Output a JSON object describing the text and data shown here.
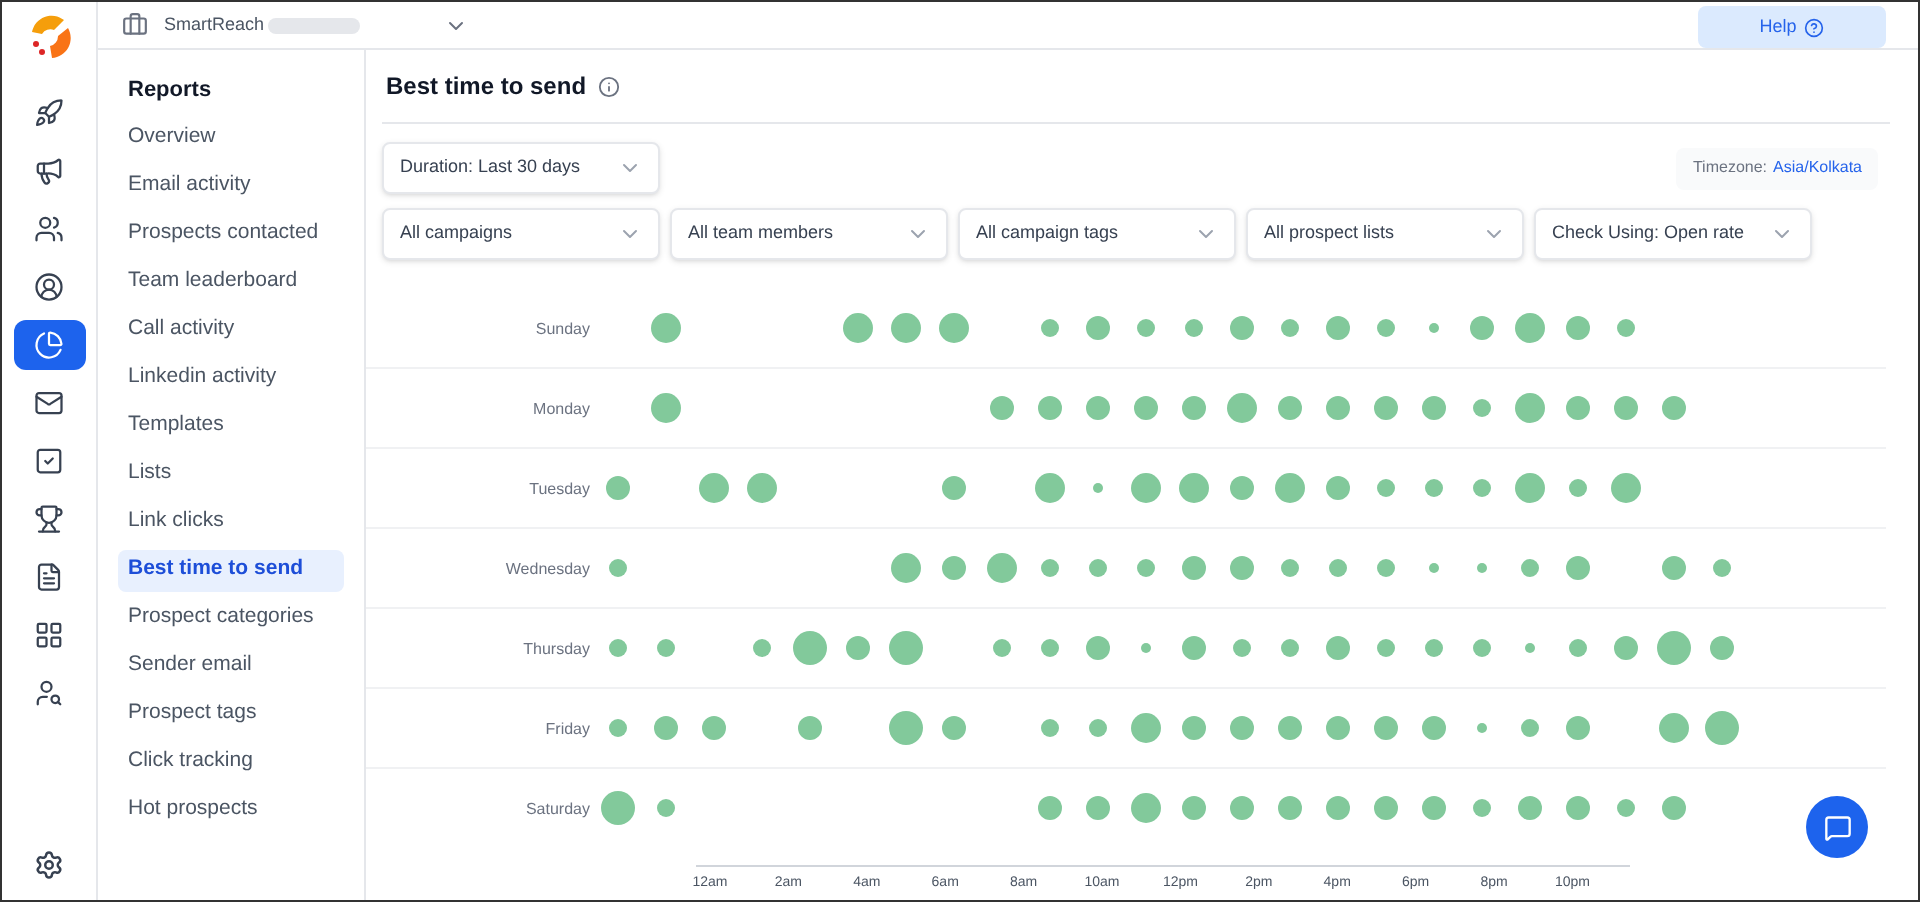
{
  "rail_items": [
    {
      "selected": false
    },
    {
      "selected": false
    },
    {
      "selected": false
    },
    {
      "selected": false
    },
    {
      "selected": true
    },
    {
      "selected": false
    },
    {
      "selected": false
    },
    {
      "selected": false
    },
    {
      "selected": false
    },
    {
      "selected": false
    },
    {
      "selected": false
    }
  ],
  "top_bar": {
    "workspace": "SmartReach",
    "help": "Help"
  },
  "sidebar": {
    "title": "Reports",
    "items": [
      {
        "label": "Overview",
        "selected": false
      },
      {
        "label": "Email activity",
        "selected": false
      },
      {
        "label": "Prospects contacted",
        "selected": false
      },
      {
        "label": "Team leaderboard",
        "selected": false
      },
      {
        "label": "Call activity",
        "selected": false
      },
      {
        "label": "Linkedin activity",
        "selected": false
      },
      {
        "label": "Templates",
        "selected": false
      },
      {
        "label": "Lists",
        "selected": false
      },
      {
        "label": "Link clicks",
        "selected": false
      },
      {
        "label": "Best time to send",
        "selected": true
      },
      {
        "label": "Prospect categories",
        "selected": false
      },
      {
        "label": "Sender email",
        "selected": false
      },
      {
        "label": "Prospect tags",
        "selected": false
      },
      {
        "label": "Click tracking",
        "selected": false
      },
      {
        "label": "Hot prospects",
        "selected": false
      }
    ]
  },
  "page": {
    "title": "Best time to send",
    "duration": "Duration: Last 30 days",
    "timezone_label": "Timezone:",
    "timezone_value": "Asia/Kolkata",
    "filters": [
      "All campaigns",
      "All team members",
      "All campaign tags",
      "All prospect lists",
      "Check Using: Open rate"
    ],
    "punch_card": {
      "rows": [
        {
          "day": "Sunday",
          "slots": [
            {
              "kind": "none"
            },
            {
              "kind": "l"
            },
            {
              "kind": "none"
            },
            {
              "kind": "none"
            },
            {
              "kind": "none"
            },
            {
              "kind": "l"
            },
            {
              "kind": "l"
            },
            {
              "kind": "l"
            },
            {
              "kind": "none"
            },
            {
              "kind": "s"
            },
            {
              "kind": "m"
            },
            {
              "kind": "s"
            },
            {
              "kind": "s"
            },
            {
              "kind": "m"
            },
            {
              "kind": "s"
            },
            {
              "kind": "m"
            },
            {
              "kind": "s"
            },
            {
              "kind": "xs"
            },
            {
              "kind": "m"
            },
            {
              "kind": "l"
            },
            {
              "kind": "m"
            },
            {
              "kind": "s"
            },
            {
              "kind": "none"
            },
            {
              "kind": "none"
            }
          ]
        },
        {
          "day": "Monday",
          "slots": [
            {
              "kind": "none"
            },
            {
              "kind": "l"
            },
            {
              "kind": "none"
            },
            {
              "kind": "none"
            },
            {
              "kind": "none"
            },
            {
              "kind": "none"
            },
            {
              "kind": "none"
            },
            {
              "kind": "none"
            },
            {
              "kind": "m"
            },
            {
              "kind": "m"
            },
            {
              "kind": "m"
            },
            {
              "kind": "m"
            },
            {
              "kind": "m"
            },
            {
              "kind": "l"
            },
            {
              "kind": "m"
            },
            {
              "kind": "m"
            },
            {
              "kind": "m"
            },
            {
              "kind": "m"
            },
            {
              "kind": "s"
            },
            {
              "kind": "l"
            },
            {
              "kind": "m"
            },
            {
              "kind": "m"
            },
            {
              "kind": "m"
            },
            {
              "kind": "none"
            }
          ]
        },
        {
          "day": "Tuesday",
          "slots": [
            {
              "kind": "m"
            },
            {
              "kind": "none"
            },
            {
              "kind": "l"
            },
            {
              "kind": "l"
            },
            {
              "kind": "none"
            },
            {
              "kind": "none"
            },
            {
              "kind": "none"
            },
            {
              "kind": "m"
            },
            {
              "kind": "none"
            },
            {
              "kind": "l"
            },
            {
              "kind": "xs"
            },
            {
              "kind": "l"
            },
            {
              "kind": "l"
            },
            {
              "kind": "m"
            },
            {
              "kind": "l"
            },
            {
              "kind": "m"
            },
            {
              "kind": "s"
            },
            {
              "kind": "s"
            },
            {
              "kind": "s"
            },
            {
              "kind": "l"
            },
            {
              "kind": "s"
            },
            {
              "kind": "l"
            },
            {
              "kind": "none"
            },
            {
              "kind": "none"
            }
          ]
        },
        {
          "day": "Wednesday",
          "slots": [
            {
              "kind": "s"
            },
            {
              "kind": "none"
            },
            {
              "kind": "none"
            },
            {
              "kind": "none"
            },
            {
              "kind": "none"
            },
            {
              "kind": "none"
            },
            {
              "kind": "l"
            },
            {
              "kind": "m"
            },
            {
              "kind": "l"
            },
            {
              "kind": "s"
            },
            {
              "kind": "s"
            },
            {
              "kind": "s"
            },
            {
              "kind": "m"
            },
            {
              "kind": "m"
            },
            {
              "kind": "s"
            },
            {
              "kind": "s"
            },
            {
              "kind": "s"
            },
            {
              "kind": "xs"
            },
            {
              "kind": "xs"
            },
            {
              "kind": "s"
            },
            {
              "kind": "m"
            },
            {
              "kind": "none"
            },
            {
              "kind": "m"
            },
            {
              "kind": "s"
            }
          ]
        },
        {
          "day": "Thursday",
          "slots": [
            {
              "kind": "s"
            },
            {
              "kind": "s"
            },
            {
              "kind": "none"
            },
            {
              "kind": "s"
            },
            {
              "kind": "xl"
            },
            {
              "kind": "m"
            },
            {
              "kind": "xl"
            },
            {
              "kind": "none"
            },
            {
              "kind": "s"
            },
            {
              "kind": "s"
            },
            {
              "kind": "m"
            },
            {
              "kind": "xs"
            },
            {
              "kind": "m"
            },
            {
              "kind": "s"
            },
            {
              "kind": "s"
            },
            {
              "kind": "m"
            },
            {
              "kind": "s"
            },
            {
              "kind": "s"
            },
            {
              "kind": "s"
            },
            {
              "kind": "xs"
            },
            {
              "kind": "s"
            },
            {
              "kind": "m"
            },
            {
              "kind": "xl"
            },
            {
              "kind": "m"
            }
          ]
        },
        {
          "day": "Friday",
          "slots": [
            {
              "kind": "s"
            },
            {
              "kind": "m"
            },
            {
              "kind": "m"
            },
            {
              "kind": "none"
            },
            {
              "kind": "m"
            },
            {
              "kind": "none"
            },
            {
              "kind": "xl"
            },
            {
              "kind": "m"
            },
            {
              "kind": "none"
            },
            {
              "kind": "s"
            },
            {
              "kind": "s"
            },
            {
              "kind": "l"
            },
            {
              "kind": "m"
            },
            {
              "kind": "m"
            },
            {
              "kind": "m"
            },
            {
              "kind": "m"
            },
            {
              "kind": "m"
            },
            {
              "kind": "m"
            },
            {
              "kind": "xs"
            },
            {
              "kind": "s"
            },
            {
              "kind": "m"
            },
            {
              "kind": "none"
            },
            {
              "kind": "l"
            },
            {
              "kind": "xl"
            }
          ]
        },
        {
          "day": "Saturday",
          "slots": [
            {
              "kind": "xl"
            },
            {
              "kind": "s"
            },
            {
              "kind": "none"
            },
            {
              "kind": "none"
            },
            {
              "kind": "none"
            },
            {
              "kind": "none"
            },
            {
              "kind": "none"
            },
            {
              "kind": "none"
            },
            {
              "kind": "none"
            },
            {
              "kind": "m"
            },
            {
              "kind": "m"
            },
            {
              "kind": "l"
            },
            {
              "kind": "m"
            },
            {
              "kind": "m"
            },
            {
              "kind": "m"
            },
            {
              "kind": "m"
            },
            {
              "kind": "m"
            },
            {
              "kind": "m"
            },
            {
              "kind": "s"
            },
            {
              "kind": "m"
            },
            {
              "kind": "m"
            },
            {
              "kind": "s"
            },
            {
              "kind": "m"
            },
            {
              "kind": "none"
            }
          ]
        }
      ],
      "hour_labels": [
        "12am",
        "2am",
        "4am",
        "6am",
        "8am",
        "10am",
        "12pm",
        "2pm",
        "4pm",
        "6pm",
        "8pm",
        "10pm"
      ]
    }
  }
}
